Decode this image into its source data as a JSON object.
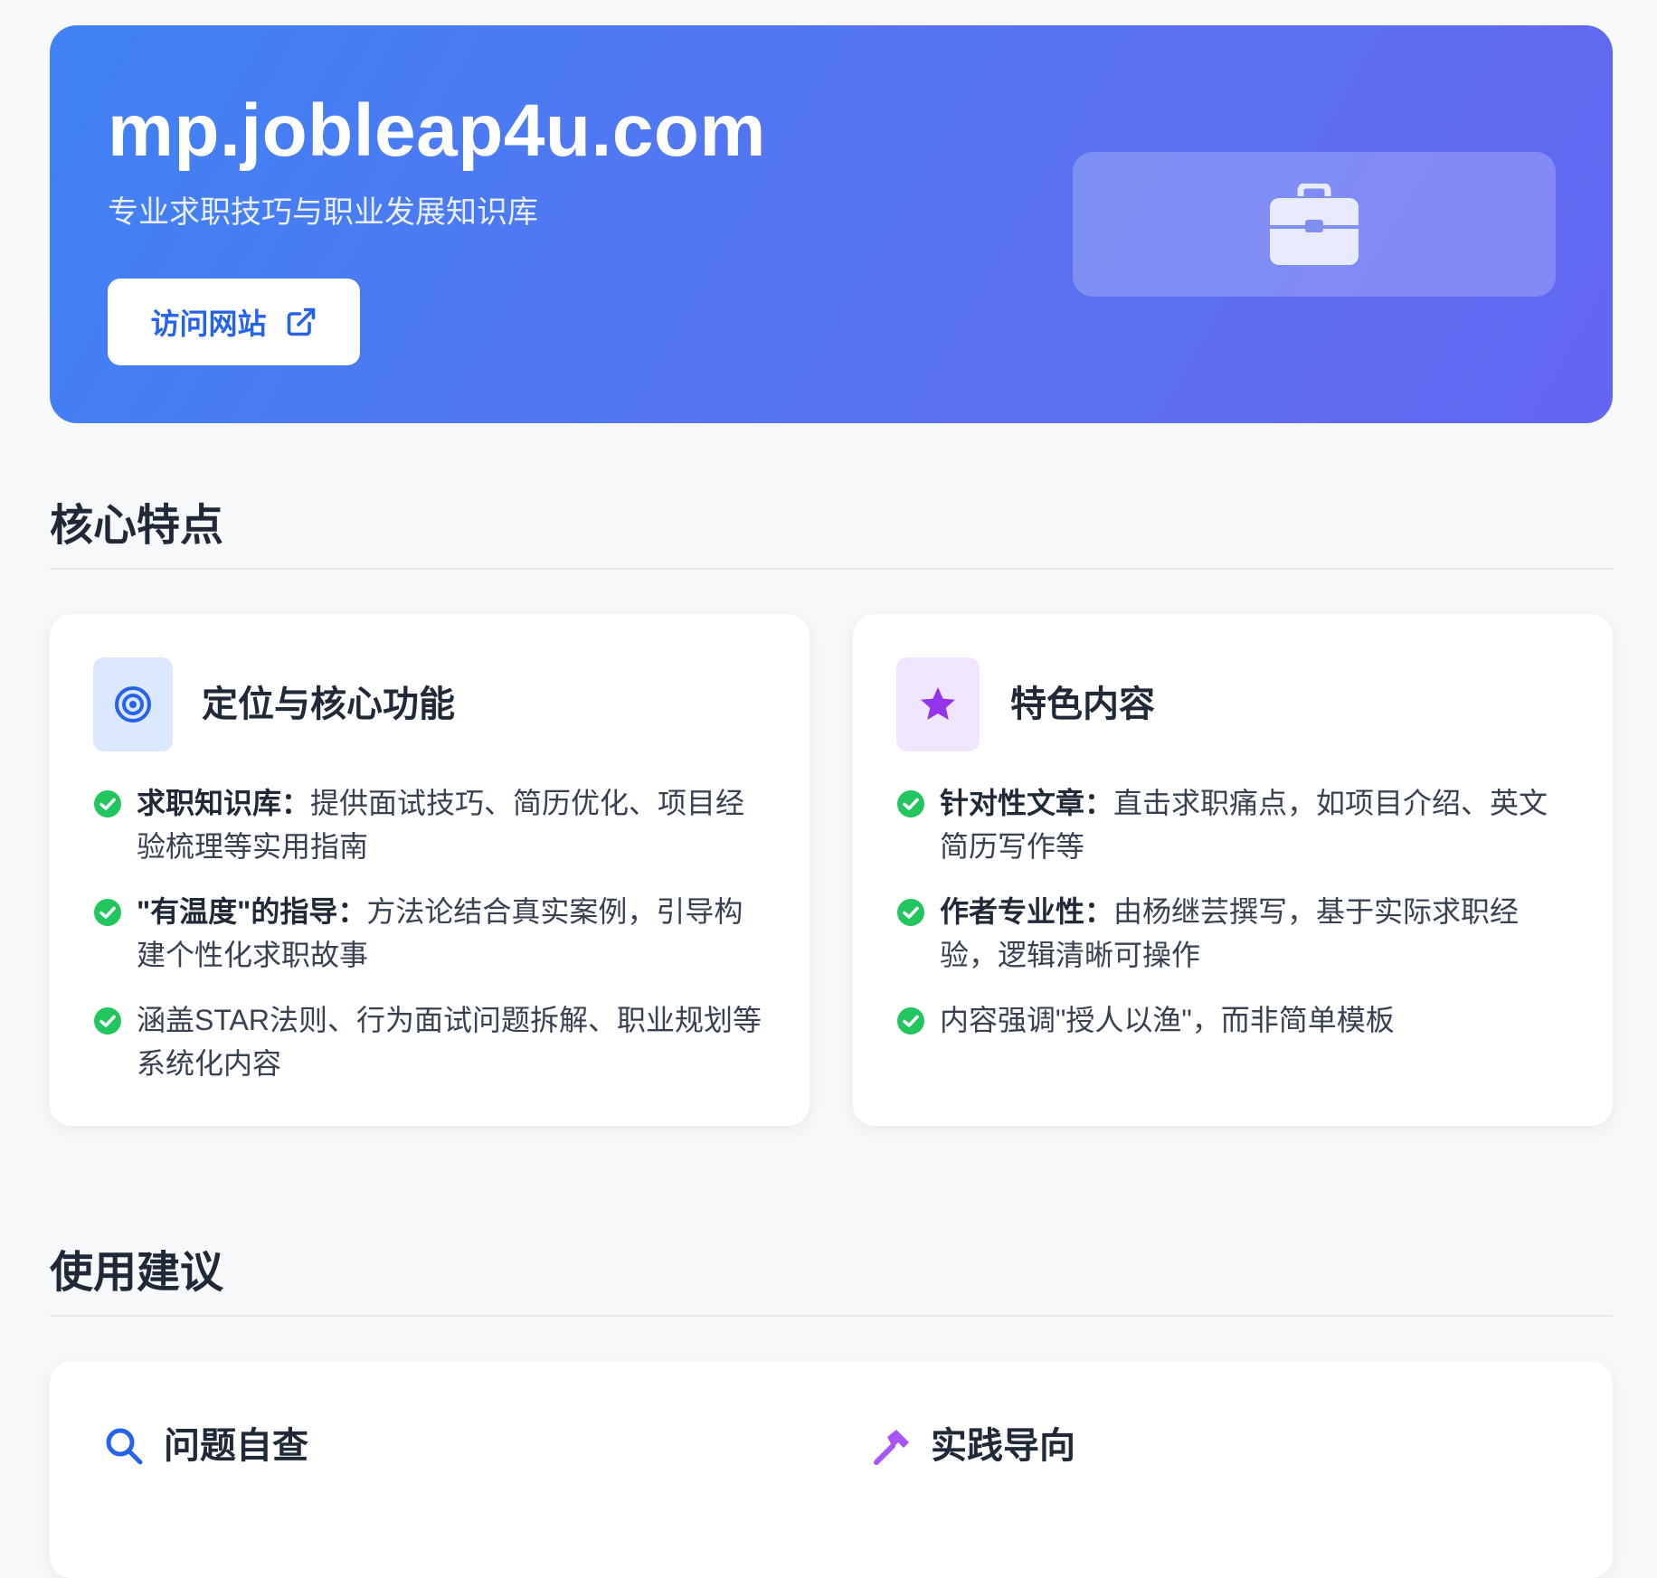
{
  "hero": {
    "title": "mp.jobleap4u.com",
    "subtitle": "专业求职技巧与职业发展知识库",
    "visit_button_label": "访问网站",
    "visit_icon": "external-link-icon",
    "art_icon": "briefcase-icon"
  },
  "features_section": {
    "title": "核心特点",
    "cards": [
      {
        "title": "定位与核心功能",
        "icon": "target-icon",
        "items": [
          {
            "lead": "求职知识库：",
            "text": "提供面试技巧、简历优化、项目经验梳理等实用指南"
          },
          {
            "lead": "\"有温度\"的指导：",
            "text": "方法论结合真实案例，引导构建个性化求职故事"
          },
          {
            "lead": "",
            "text": "涵盖STAR法则、行为面试问题拆解、职业规划等系统化内容"
          }
        ]
      },
      {
        "title": "特色内容",
        "icon": "star-icon",
        "items": [
          {
            "lead": "针对性文章：",
            "text": "直击求职痛点，如项目介绍、英文简历写作等"
          },
          {
            "lead": "作者专业性：",
            "text": "由杨继芸撰写，基于实际求职经验，逻辑清晰可操作"
          },
          {
            "lead": "",
            "text": "内容强调\"授人以渔\"，而非简单模板"
          }
        ]
      }
    ]
  },
  "usage_section": {
    "title": "使用建议",
    "items": [
      {
        "title": "问题自查",
        "icon": "search-icon"
      },
      {
        "title": "实践导向",
        "icon": "hammer-icon"
      }
    ]
  },
  "colors": {
    "hero_gradient_start": "#3f82f4",
    "hero_gradient_end": "#6366f1",
    "accent_blue": "#2563eb",
    "check_green": "#22c55e",
    "accent_purple": "#9333ea"
  }
}
